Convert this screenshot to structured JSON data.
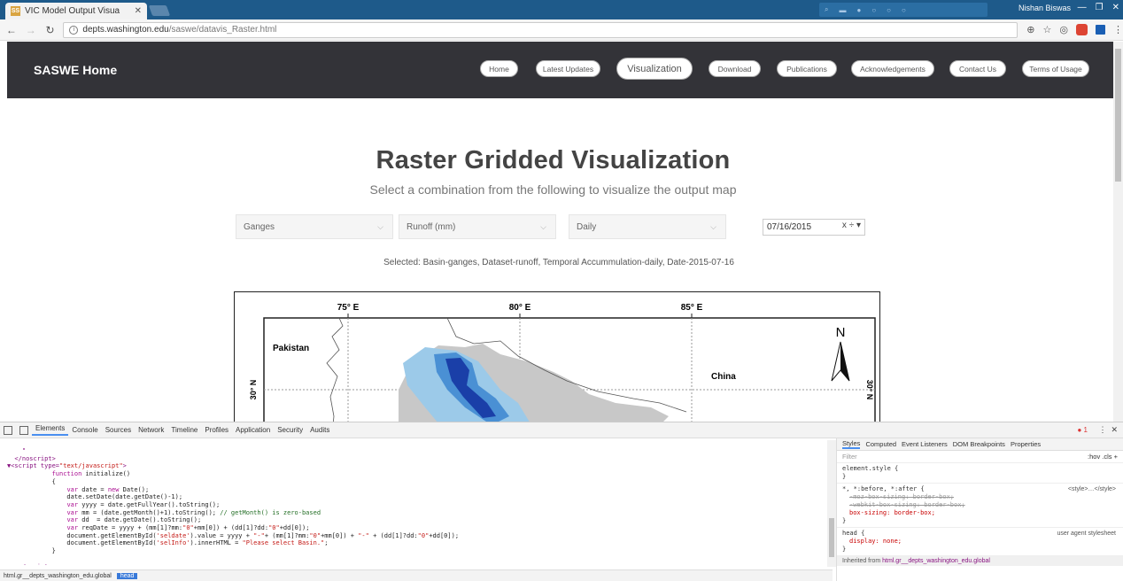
{
  "browser": {
    "tab_title": "VIC Model Output Visua",
    "favicon_text": "SS",
    "url_host": "depts.washington.edu",
    "url_path": "/saswe/datavis_Raster.html",
    "user_name": "Nishan Biswas"
  },
  "navbar": {
    "brand": "SASWE Home",
    "items": [
      "Home",
      "Latest Updates",
      "Visualization",
      "Download",
      "Publications",
      "Acknowledgements",
      "Contact Us",
      "Terms of Usage"
    ],
    "active": "Visualization"
  },
  "page": {
    "title": "Raster Gridded Visualization",
    "subtitle": "Select a combination from the following to visualize the output map",
    "selects": {
      "basin": "Ganges",
      "dataset": "Runoff (mm)",
      "temporal": "Daily"
    },
    "date_value": "07/16/2015",
    "date_controls": "x ÷ ▾",
    "sel_info": "Selected: Basin-ganges, Dataset-runoff, Temporal Accummulation-daily, Date-2015-07-16"
  },
  "map": {
    "lon_labels": [
      "75° E",
      "80° E",
      "85° E"
    ],
    "lat_label": "30° N",
    "place_labels": [
      "Pakistan",
      "China"
    ],
    "north_label": "N"
  },
  "devtools": {
    "tabs": [
      "Elements",
      "Console",
      "Sources",
      "Network",
      "Timeline",
      "Profiles",
      "Application",
      "Security",
      "Audits"
    ],
    "active_tab": "Elements",
    "error_count": "1",
    "breadcrumb": [
      "html.gr__depts_washington_edu.global",
      "head"
    ],
    "styles_tabs": [
      "Styles",
      "Computed",
      "Event Listeners",
      "DOM Breakpoints",
      "Properties"
    ],
    "filter_placeholder": "Filter",
    "filter_buttons": ":hov  .cls  +",
    "rule_element_style": "element.style {",
    "rule_universal_selector": "*, *:before, *:after {",
    "rule_universal_source": "<style>…</style>",
    "rule_moz": "-moz-box-sizing: border-box;",
    "rule_webkit": "-webkit-box-sizing: border-box;",
    "rule_box": "box-sizing: border-box;",
    "rule_head": "head {",
    "rule_head_source": "user agent stylesheet",
    "rule_display": "display: none;",
    "inherited_prefix": "Inherited from ",
    "inherited_from": "html.gr__depts_washington_edu.global"
  }
}
